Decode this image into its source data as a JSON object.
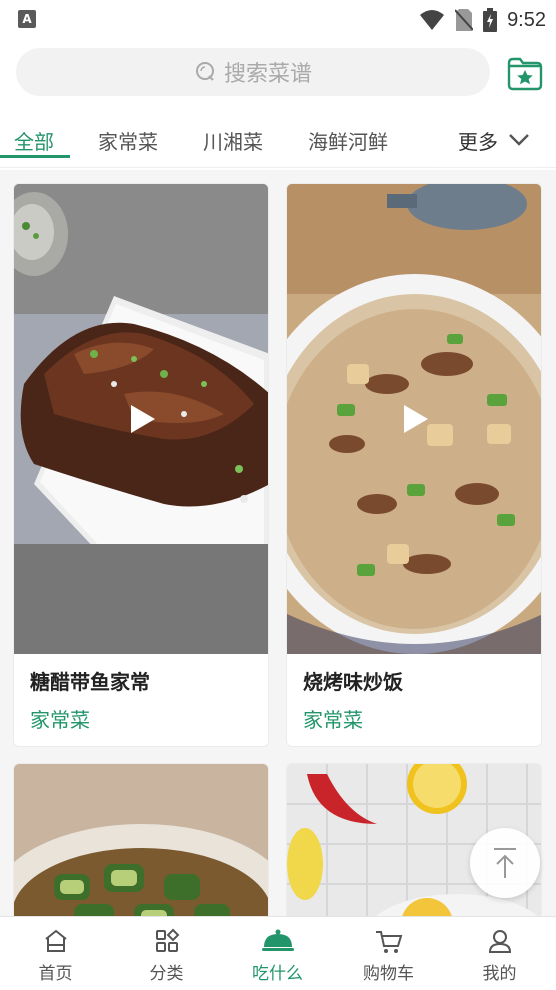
{
  "status_bar": {
    "time": "9:52"
  },
  "search": {
    "placeholder": "搜索菜谱"
  },
  "tabs": [
    {
      "label": "全部",
      "active": true
    },
    {
      "label": "家常菜",
      "active": false
    },
    {
      "label": "川湘菜",
      "active": false
    },
    {
      "label": "海鲜河鲜",
      "active": false
    }
  ],
  "more_label": "更多",
  "cards": [
    {
      "title": "糖醋带鱼家常",
      "category": "家常菜"
    },
    {
      "title": "烧烤味炒饭",
      "category": "家常菜"
    }
  ],
  "bottom_nav": [
    {
      "label": "首页",
      "icon": "home-icon"
    },
    {
      "label": "分类",
      "icon": "grid-icon"
    },
    {
      "label": "吃什么",
      "icon": "dish-cover-icon",
      "active": true
    },
    {
      "label": "购物车",
      "icon": "cart-icon"
    },
    {
      "label": "我的",
      "icon": "user-icon"
    }
  ],
  "colors": {
    "accent": "#23956b"
  }
}
